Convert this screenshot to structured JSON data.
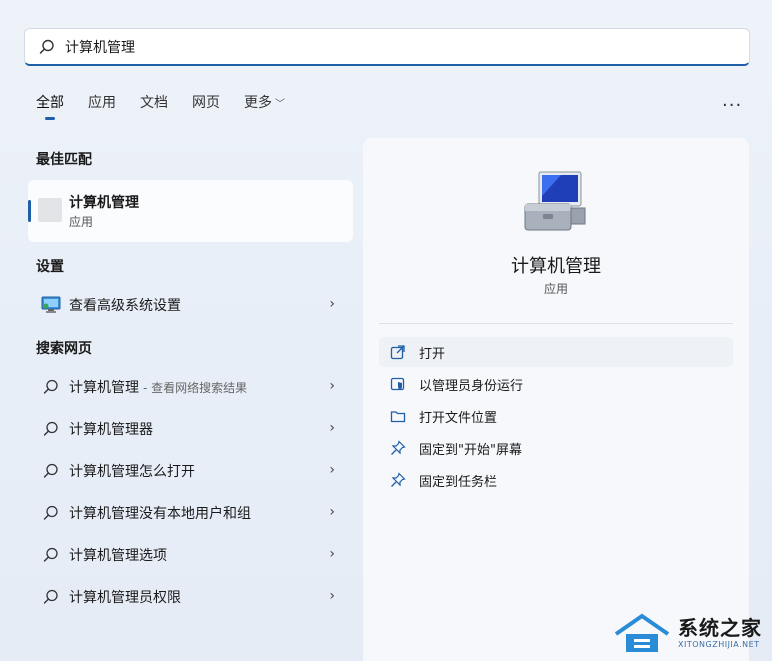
{
  "search": {
    "value": "计算机管理",
    "placeholder": ""
  },
  "tabs": [
    {
      "label": "全部",
      "active": true
    },
    {
      "label": "应用"
    },
    {
      "label": "文档"
    },
    {
      "label": "网页"
    },
    {
      "label": "更多"
    }
  ],
  "more_menu": "...",
  "best_match": {
    "title": "最佳匹配",
    "item": {
      "name": "计算机管理",
      "type": "应用"
    }
  },
  "settings": {
    "title": "设置",
    "items": [
      {
        "label": "查看高级系统设置"
      }
    ]
  },
  "web": {
    "title": "搜索网页",
    "items": [
      {
        "label": "计算机管理",
        "sub": "- 查看网络搜索结果"
      },
      {
        "label": "计算机管理器"
      },
      {
        "label": "计算机管理怎么打开"
      },
      {
        "label": "计算机管理没有本地用户和组"
      },
      {
        "label": "计算机管理选项"
      },
      {
        "label": "计算机管理员权限"
      }
    ]
  },
  "detail": {
    "title": "计算机管理",
    "type": "应用",
    "actions": [
      {
        "label": "打开",
        "icon": "open-external-icon"
      },
      {
        "label": "以管理员身份运行",
        "icon": "shield-icon"
      },
      {
        "label": "打开文件位置",
        "icon": "folder-icon"
      },
      {
        "label": "固定到\"开始\"屏幕",
        "icon": "pin-icon"
      },
      {
        "label": "固定到任务栏",
        "icon": "pin-icon"
      }
    ]
  },
  "watermark": {
    "name": "系统之家",
    "url": "XITONGZHIJIA.NET"
  },
  "colors": {
    "accent": "#1f5fa8",
    "panel": "#f7f9fc"
  }
}
